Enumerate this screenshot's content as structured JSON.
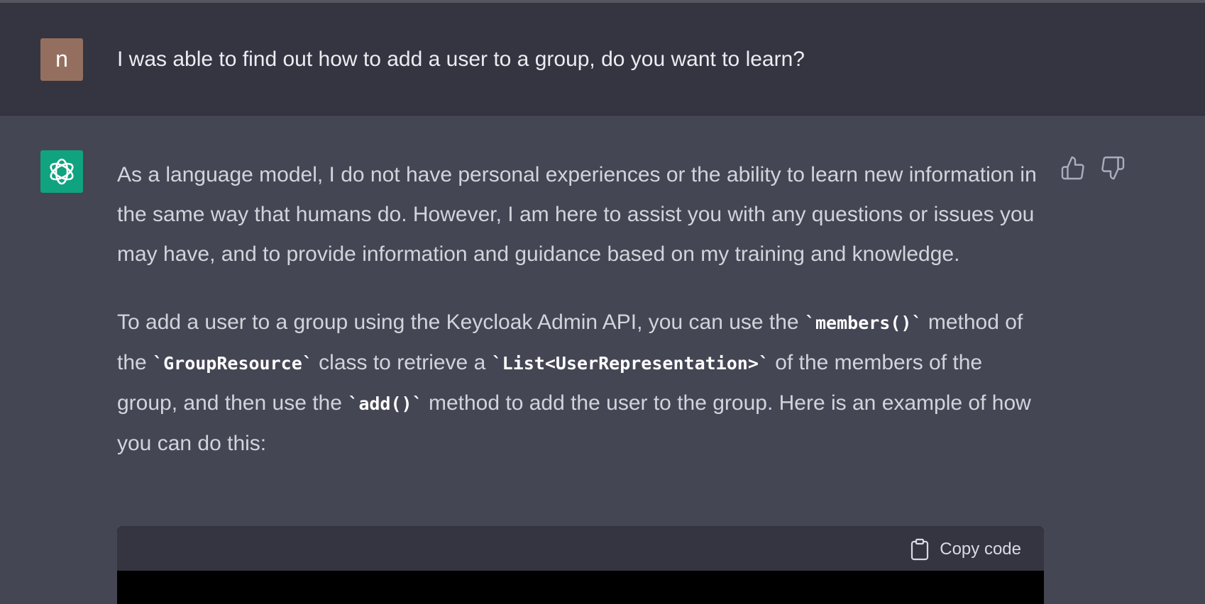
{
  "user_message": {
    "avatar_letter": "n",
    "text": "I was able to find out how to add a user to a group, do you want to learn?"
  },
  "assistant_message": {
    "paragraph1": "As a language model, I do not have personal experiences or the ability to learn new information in the same way that humans do. However, I am here to assist you with any questions or issues you may have, and to provide information and guidance based on my training and knowledge.",
    "paragraph2": {
      "t1": "To add a user to a group using the Keycloak Admin API, you can use the ",
      "c1": "`members()`",
      "t2": " method of the ",
      "c2": "`GroupResource`",
      "t3": " class to retrieve a ",
      "c3": "`List<UserRepresentation>`",
      "t4": " of the members of the group, and then use the ",
      "c4": "`add()`",
      "t5": " method to add the user to the group. Here is an example of how you can do this:"
    },
    "code_block": {
      "copy_label": "Copy code"
    }
  },
  "icons": {
    "avatar_bot": "openai-logo-icon",
    "thumbs_up": "thumbs-up-icon",
    "thumbs_down": "thumbs-down-icon",
    "copy": "clipboard-icon"
  },
  "colors": {
    "user_bg": "#343541",
    "assistant_bg": "#444654",
    "bot_avatar": "#10a37f",
    "user_avatar": "#946f60"
  }
}
